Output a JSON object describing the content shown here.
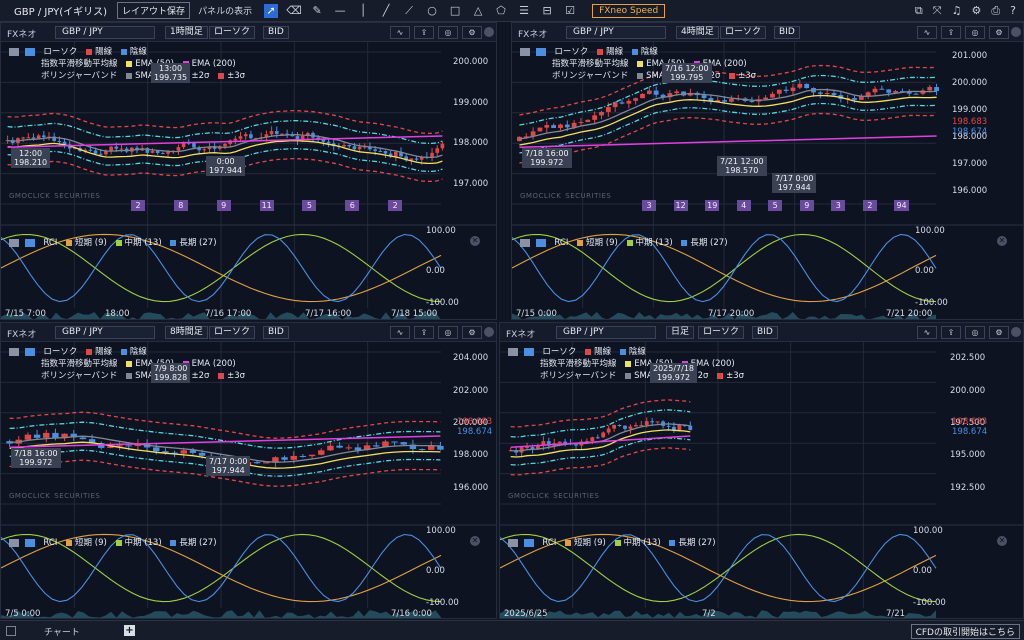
{
  "topbar": {
    "title": "GBP / JPY(イギリス)",
    "layout_save": "レイアウト保存",
    "panel_display": "パネルの表示",
    "fxneo_speed": "FXneo Speed"
  },
  "bottombar": {
    "tab": "チャート",
    "plus": "+",
    "cfd": "CFDの取引開始はこちら"
  },
  "common": {
    "fx": "FXネオ",
    "pair": "GBP / JPY",
    "chart_type": "ローソク",
    "side": "BID",
    "candle": "ローソク",
    "up": "陽線",
    "down": "陰線",
    "ema_label": "指数平滑移動平均線",
    "ema50": "EMA (50)",
    "ema200": "EMA (200)",
    "bb_label": "ボリンジャーバンド",
    "sma20": "SMA (20)",
    "s2": "±2σ",
    "s3": "±3σ",
    "rci": "RCI",
    "short": "短期 (9)",
    "mid": "中期 (13)",
    "long": "長期 (27)",
    "watermark": "GMOCLICK",
    "watermark_sub": "SECURITIES",
    "colors": {
      "up": "#e04848",
      "down": "#4a8fe0",
      "ema50": "#f0e060",
      "ema200": "#e040e0",
      "sma20": "#808894",
      "s2": "#50d8e0",
      "s3": "#e04848",
      "rci_short": "#e0a040",
      "rci_mid": "#a0d040",
      "rci_long": "#4a8fe0"
    }
  },
  "panels": [
    {
      "timeframe": "1時間足",
      "yticks": [
        "200.000",
        "199.000",
        "198.000",
        "197.000"
      ],
      "rci_ticks": [
        "100.00",
        "0.00",
        "-100.00"
      ],
      "xticks": [
        "7/15 7:00",
        "18:00",
        "7/16 17:00",
        "7/17 16:00",
        "7/18 15:00"
      ],
      "labels": [
        {
          "t1": "13:00",
          "t2": "199.735"
        },
        {
          "t1": "12:00",
          "t2": "198.210"
        },
        {
          "t1": "0:00",
          "t2": "197.944"
        }
      ],
      "badges": [
        "2",
        "8",
        "9",
        "11",
        "5",
        "6",
        "2"
      ]
    },
    {
      "timeframe": "4時間足",
      "yticks": [
        "201.000",
        "200.000",
        "199.000",
        "198.000",
        "197.000",
        "196.000"
      ],
      "rci_ticks": [
        "100.00",
        "0.00",
        "-100.00"
      ],
      "xticks": [
        "7/15 0:00",
        "7/17 20:00",
        "7/21 20:00"
      ],
      "labels": [
        {
          "t1": "7/16 12:00",
          "t2": "199.795"
        },
        {
          "t1": "7/18 16:00",
          "t2": "199.972"
        },
        {
          "t1": "7/21 12:00",
          "t2": "198.570"
        },
        {
          "t1": "7/17 0:00",
          "t2": "197.944"
        }
      ],
      "price_red": "198.683",
      "price_blue": "198.674",
      "badges": [
        "3",
        "12",
        "19",
        "4",
        "5",
        "9",
        "3",
        "2",
        "94"
      ]
    },
    {
      "timeframe": "8時間足",
      "yticks": [
        "204.000",
        "202.000",
        "200.000",
        "198.000",
        "196.000"
      ],
      "rci_ticks": [
        "100.00",
        "0.00",
        "-100.00"
      ],
      "xticks": [
        "7/5 0:00",
        "7/16 0:00"
      ],
      "labels": [
        {
          "t1": "7/9 8:00",
          "t2": "199.828"
        },
        {
          "t1": "7/18 16:00",
          "t2": "199.972"
        },
        {
          "t1": "7/17 0:00",
          "t2": "197.944"
        }
      ],
      "price_red": "198.683",
      "price_blue": "198.674"
    },
    {
      "timeframe": "日足",
      "yticks": [
        "202.500",
        "200.000",
        "197.500",
        "195.000",
        "192.500"
      ],
      "rci_ticks": [
        "100.00",
        "0.00",
        "-100.00"
      ],
      "xticks": [
        "2025/6/25",
        "7/2",
        "7/21"
      ],
      "labels": [
        {
          "t1": "2025/7/18",
          "t2": "199.972"
        }
      ],
      "price_red": "198.683",
      "price_blue": "198.674"
    }
  ]
}
